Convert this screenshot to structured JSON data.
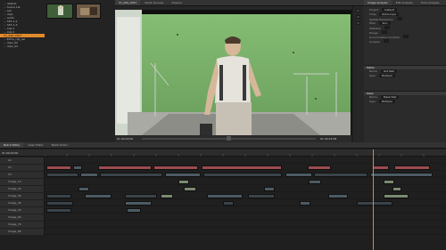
{
  "menubar": {
    "tabs": [
      {
        "label": "Spark Queues"
      },
      {
        "label": "Viewers"
      }
    ]
  },
  "viewer": {
    "tab_label": "V1_020_0027",
    "timecode_left": "01:00:00:00",
    "timecode_right": "01:00:24:08"
  },
  "media_tree": {
    "items": [
      {
        "label": "... default"
      },
      {
        "label": "... Scene 1st"
      },
      {
        "label": "... sub"
      },
      {
        "label": "... clips"
      },
      {
        "label": "... audio"
      },
      {
        "label": "... SFX 1-2"
      },
      {
        "label": "... SFX 1-3"
      },
      {
        "label": "... Clip 1"
      },
      {
        "label": "... Clip 2"
      },
      {
        "label": "V1_020_0027",
        "selected": true
      },
      {
        "label": "... Extra_clip_sel"
      },
      {
        "label": "... clips_02"
      },
      {
        "label": "... clips_03"
      }
    ]
  },
  "properties": {
    "tabs": [
      {
        "label": "Image Analysis"
      },
      {
        "label": "Edit Analysis"
      },
      {
        "label": "Time Analysis"
      }
    ],
    "rows": [
      {
        "label": "Project",
        "value": "Default"
      },
      {
        "label": "Time",
        "value": "Rotoscope"
      },
      {
        "label": "Spatial Resolution",
        "value": ""
      },
      {
        "label": "Filter",
        "value": "Sinc"
      },
      {
        "label": "Stabilize",
        "value": ""
      },
      {
        "label": "Range",
        "value": ""
      },
      {
        "label": "Accumulation Duration",
        "value": ""
      },
      {
        "label": "Analyze",
        "value": ""
      }
    ],
    "sections": [
      {
        "label": "Matte",
        "sub": [
          {
            "label": "Name",
            "value": "Out Nail"
          },
          {
            "label": "Type",
            "value": "Multiple"
          }
        ]
      },
      {
        "label": "Mask",
        "sub": [
          {
            "label": "Name",
            "value": "Mask Nail"
          },
          {
            "label": "Type",
            "value": "Multiple"
          }
        ]
      }
    ]
  },
  "timeline": {
    "tabs": [
      {
        "label": "Batch Editor"
      },
      {
        "label": "Desk Editor"
      },
      {
        "label": "Batch Editor"
      }
    ],
    "timecode": "01:00:00:00",
    "tracks": [
      {
        "label": "A1"
      },
      {
        "label": "V1"
      },
      {
        "label": "V1"
      },
      {
        "label": "Image_1b"
      },
      {
        "label": "Image_2b"
      },
      {
        "label": "Image_3b"
      },
      {
        "label": "Image_4b"
      },
      {
        "label": "Image_5b"
      },
      {
        "label": "Image_6b"
      },
      {
        "label": "Image_7b"
      },
      {
        "label": "Image_8b"
      }
    ]
  },
  "colors": {
    "accent": "#e08a2b",
    "audio_clip": "#9c4b4f",
    "video_clip": "#4c5a63",
    "greenscreen": "#7fb56f"
  }
}
